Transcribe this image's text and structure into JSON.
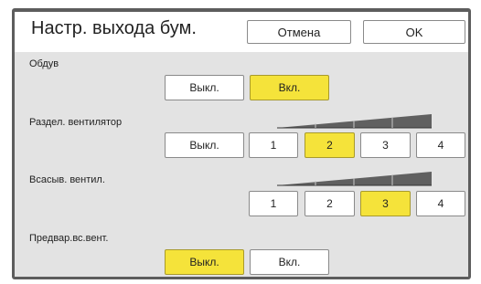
{
  "header": {
    "title": "Настр. выхода бум.",
    "cancel_label": "Отмена",
    "ok_label": "OK"
  },
  "settings": {
    "blow": {
      "label": "Обдув",
      "options": [
        "Выкл.",
        "Вкл."
      ],
      "selected": "Вкл."
    },
    "separation_fan": {
      "label": "Раздел. вентилятор",
      "options": [
        "Выкл.",
        "1",
        "2",
        "3",
        "4"
      ],
      "selected": "2"
    },
    "suction_fan": {
      "label": "Всасыв. вентил.",
      "options": [
        "1",
        "2",
        "3",
        "4"
      ],
      "selected": "3"
    },
    "pre_suction_fan": {
      "label": "Предвар.вс.вент.",
      "options": [
        "Выкл.",
        "Вкл."
      ],
      "selected": "Выкл."
    }
  },
  "colors": {
    "selected": "#f5e33a",
    "panel_bg": "#e3e3e3",
    "ramp": "#606060"
  }
}
